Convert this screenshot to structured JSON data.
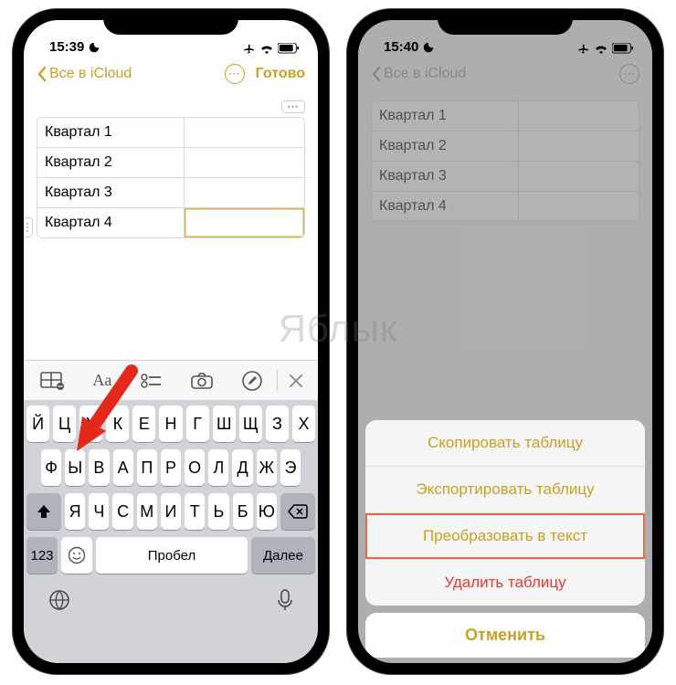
{
  "status": {
    "time_left": "15:39",
    "time_right": "15:40"
  },
  "nav": {
    "back_label": "Все в iCloud",
    "done": "Готово"
  },
  "table": {
    "rows": [
      "Квартал 1",
      "Квартал 2",
      "Квартал 3",
      "Квартал 4"
    ]
  },
  "toolbar": {
    "text_style": "Aa"
  },
  "keyboard": {
    "row1": [
      "Й",
      "Ц",
      "У",
      "К",
      "Е",
      "Н",
      "Г",
      "Ш",
      "Щ",
      "З",
      "Х"
    ],
    "row2": [
      "Ф",
      "Ы",
      "В",
      "А",
      "П",
      "Р",
      "О",
      "Л",
      "Д",
      "Ж",
      "Э"
    ],
    "row3": [
      "Я",
      "Ч",
      "С",
      "М",
      "И",
      "Т",
      "Ь",
      "Б",
      "Ю"
    ],
    "n123": "123",
    "space": "Пробел",
    "next": "Далее"
  },
  "sheet": {
    "copy": "Скопировать таблицу",
    "export": "Экспортировать таблицу",
    "convert": "Преобразовать в текст",
    "delete": "Удалить таблицу",
    "cancel": "Отменить"
  },
  "watermark": "Яблык"
}
